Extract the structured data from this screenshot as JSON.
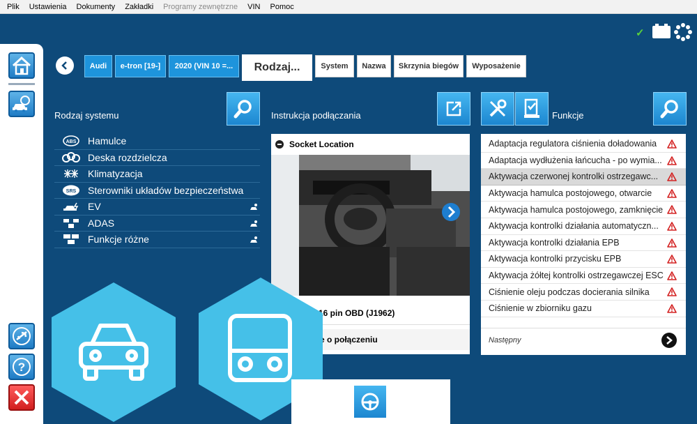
{
  "menu": {
    "items": [
      {
        "label": "Plik",
        "enabled": true
      },
      {
        "label": "Ustawienia",
        "enabled": true
      },
      {
        "label": "Dokumenty",
        "enabled": true
      },
      {
        "label": "Zakładki",
        "enabled": true
      },
      {
        "label": "Programy zewnętrzne",
        "enabled": false
      },
      {
        "label": "VIN",
        "enabled": true
      },
      {
        "label": "Pomoc",
        "enabled": true
      }
    ]
  },
  "status": {
    "check_icon": "checkmark-icon",
    "check_symbol": "✓",
    "battery_icon": "battery-icon",
    "activity_icon": "spinner-icon",
    "check_color": "#59d13c"
  },
  "left_panel": {
    "buttons": [
      "home-icon",
      "vehicle-diagnostics-icon",
      "airplane-mode-icon",
      "help-icon",
      "close-icon"
    ]
  },
  "breadcrumbs": {
    "back_icon": "back-arrow-icon",
    "items": [
      {
        "label": "Audi",
        "style": "blue"
      },
      {
        "label": "e-tron [19-]",
        "style": "blue"
      },
      {
        "label": "2020 (VIN 10 =...",
        "style": "blue"
      },
      {
        "label": "Rodzaj...",
        "style": "big"
      },
      {
        "label": "System",
        "style": "white"
      },
      {
        "label": "Nazwa",
        "style": "white"
      },
      {
        "label": "Skrzynia biegów",
        "style": "white"
      },
      {
        "label": "Wyposażenie",
        "style": "white"
      }
    ]
  },
  "systems": {
    "title": "Rodzaj systemu",
    "search_icon": "search-icon",
    "items": [
      {
        "label": "Hamulce",
        "icon": "abs-icon",
        "tail": false
      },
      {
        "label": "Deska rozdzielcza",
        "icon": "gauges-icon",
        "tail": false
      },
      {
        "label": "Klimatyzacja",
        "icon": "climate-icon",
        "tail": false
      },
      {
        "label": "Sterowniki układów bezpieczeństwa",
        "icon": "srs-icon",
        "tail": false
      },
      {
        "label": "EV",
        "icon": "ev-icon",
        "tail": true
      },
      {
        "label": "ADAS",
        "icon": "adas-icon",
        "tail": true
      },
      {
        "label": "Funkcje różne",
        "icon": "misc-functions-icon",
        "tail": true
      }
    ]
  },
  "connection": {
    "title": "Instrukcja podłączania",
    "open_icon": "external-link-icon",
    "socket_label": "Socket Location",
    "pin_text": "16 pin OBD (J1962)",
    "info_text": "cje o połączeniu"
  },
  "functions": {
    "title": "Funkcje",
    "tools_icon": "tools-icon",
    "basket_icon": "basket-icon",
    "search_icon": "search-icon",
    "items": [
      {
        "label": "Adaptacja regulatora ciśnienia doładowania",
        "selected": false
      },
      {
        "label": "Adaptacja wydłużenia łańcucha - po wymia...",
        "selected": false
      },
      {
        "label": "Aktywacja czerwonej kontrolki ostrzegawc...",
        "selected": true
      },
      {
        "label": "Aktywacja hamulca postojowego, otwarcie",
        "selected": false
      },
      {
        "label": "Aktywacja hamulca postojowego, zamknięcie",
        "selected": false
      },
      {
        "label": "Aktywacja kontrolki działania automatyczn...",
        "selected": false
      },
      {
        "label": "Aktywacja kontrolki działania EPB",
        "selected": false
      },
      {
        "label": "Aktywacja kontrolki przycisku EPB",
        "selected": false
      },
      {
        "label": "Aktywacja żółtej kontrolki ostrzegawczej ESC",
        "selected": false
      },
      {
        "label": "Ciśnienie oleju podczas docierania silnika",
        "selected": false
      },
      {
        "label": "Ciśnienie w zbiorniku gazu",
        "selected": false
      }
    ],
    "next_label": "Następny",
    "warning_color": "#d32020"
  },
  "vehicle_types": [
    "car-icon",
    "truck-icon"
  ],
  "bottom": {
    "icon": "steering-wheel-icon"
  }
}
